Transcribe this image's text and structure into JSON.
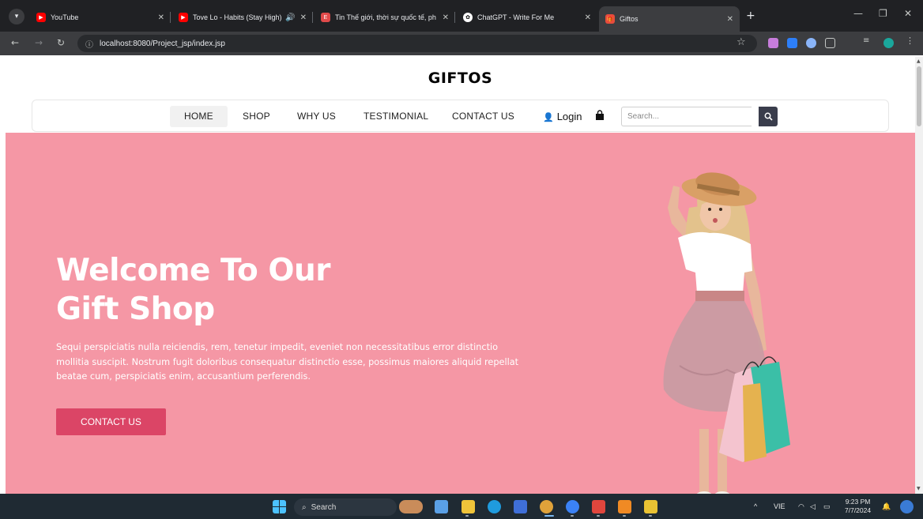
{
  "browser": {
    "tabs": [
      {
        "title": "YouTube",
        "color": "#ff0000"
      },
      {
        "title": "Tove Lo - Habits (Stay High)",
        "color": "#ff0000"
      },
      {
        "title": "Tin Thế giới, thời sự quốc tế, ph",
        "color": "#e04a4a"
      },
      {
        "title": "ChatGPT - Write For Me",
        "color": "#ffffff"
      },
      {
        "title": "Giftos",
        "color": "#e74c3c"
      }
    ],
    "url": "localhost:8080/Project_jsp/index.jsp"
  },
  "site": {
    "brand": "GIFTOS",
    "nav": [
      {
        "label": "HOME"
      },
      {
        "label": "SHOP"
      },
      {
        "label": "WHY US"
      },
      {
        "label": "TESTIMONIAL"
      },
      {
        "label": "CONTACT US"
      }
    ],
    "login_label": "Login",
    "search_placeholder": "Search..."
  },
  "hero": {
    "title_line1": "Welcome To Our",
    "title_line2": "Gift Shop",
    "text": "Sequi perspiciatis nulla reiciendis, rem, tenetur impedit, eveniet non necessitatibus error distinctio mollitia suscipit. Nostrum fugit doloribus consequatur distinctio esse, possimus maiores aliquid repellat beatae cum, perspiciatis enim, accusantium perferendis.",
    "button_label": "CONTACT US",
    "background": "#f597a5",
    "button_color": "#db4566"
  },
  "taskbar": {
    "search_label": "Search",
    "language": "VIE",
    "time": "9:23 PM",
    "date": "7/7/2024"
  }
}
